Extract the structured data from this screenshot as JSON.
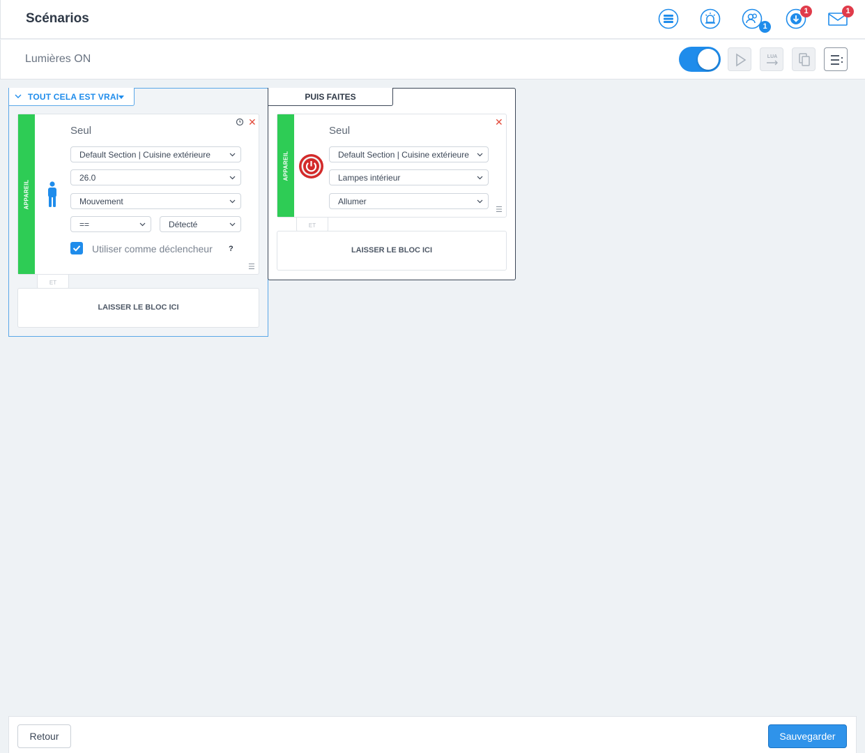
{
  "header": {
    "title": "Scénarios",
    "icons": [
      {
        "name": "sections-icon"
      },
      {
        "name": "alarm-icon"
      },
      {
        "name": "users-icon",
        "badge": "1",
        "badge_color": "#1f8ceb"
      },
      {
        "name": "download-icon",
        "badge": "1",
        "badge_color": "#e03b4a"
      },
      {
        "name": "mail-icon",
        "badge": "1",
        "badge_color": "#e03b4a"
      }
    ]
  },
  "scene": {
    "name": "Lumières ON",
    "enabled": true,
    "toolbar": [
      {
        "name": "run-icon"
      },
      {
        "name": "lua-convert-icon",
        "label": "LUA"
      },
      {
        "name": "copy-icon"
      },
      {
        "name": "menu-icon"
      }
    ]
  },
  "condition": {
    "header_label": "TOUT CELA EST VRAI",
    "block": {
      "stripe_label": "APPAREIL",
      "title": "Seul",
      "room": "Default Section | Cuisine extérieure",
      "device": "26.0",
      "property": "Mouvement",
      "operator": "==",
      "value": "Détecté",
      "trigger_label": "Utiliser comme déclencheur",
      "trigger_checked": true,
      "help": "?"
    },
    "joiner": "ET",
    "drop_label": "LAISSER LE BLOC ICI"
  },
  "action": {
    "header_label": "PUIS FAITES",
    "block": {
      "stripe_label": "APPAREIL",
      "title": "Seul",
      "room": "Default Section | Cuisine extérieure",
      "device": "Lampes intérieur",
      "action": "Allumer"
    },
    "joiner": "ET",
    "drop_label": "LAISSER LE BLOC ICI"
  },
  "footer": {
    "back_label": "Retour",
    "save_label": "Sauvegarder"
  },
  "colors": {
    "accent": "#1f8ceb",
    "device_stripe": "#2ecc55",
    "badge_red": "#e03b4a",
    "close": "#e24b3b"
  }
}
